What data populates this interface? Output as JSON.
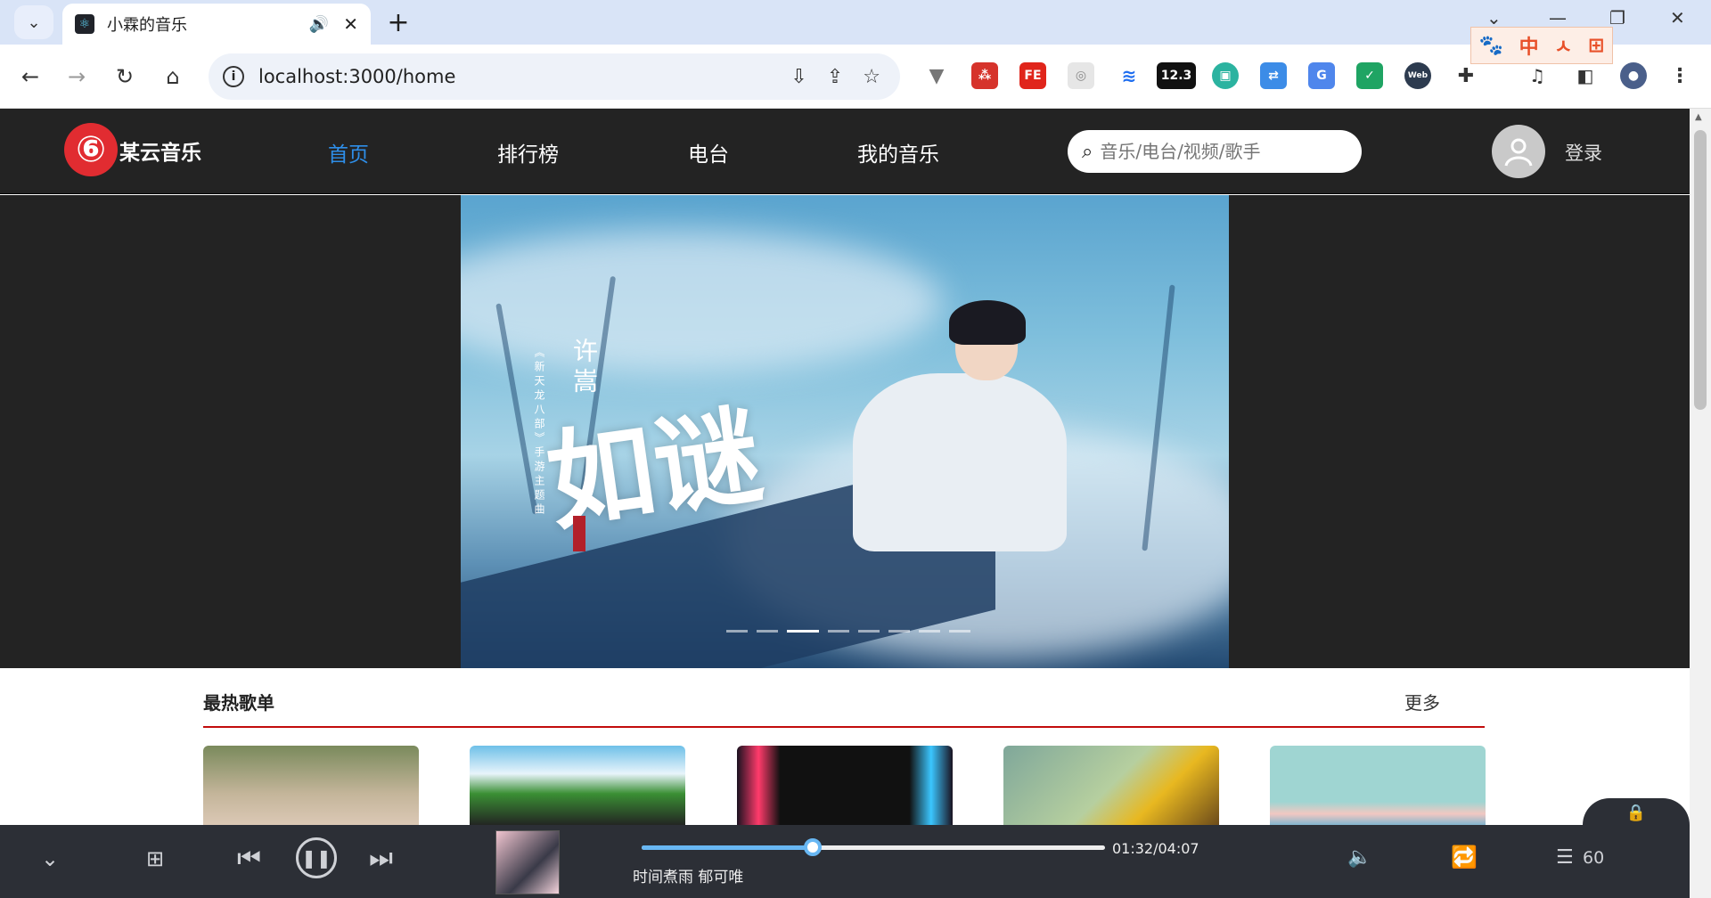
{
  "browser": {
    "tab_title": "小霖的音乐",
    "url": "localhost:3000/home",
    "ext_badge": "12.3"
  },
  "ime": {
    "items": [
      "中",
      "ㅅ",
      "⊞"
    ]
  },
  "header": {
    "logo_text": "某云音乐",
    "nav": [
      {
        "label": "首页",
        "active": true
      },
      {
        "label": "排行榜",
        "active": false
      },
      {
        "label": "电台",
        "active": false
      },
      {
        "label": "我的音乐",
        "active": false
      }
    ],
    "search_placeholder": "音乐/电台/视频/歌手",
    "login_label": "登录"
  },
  "banner": {
    "artist": "许嵩",
    "title": "如谜",
    "subtitle": "《新天龙八部》手游主题曲",
    "dot_count": 8,
    "active_dot": 2
  },
  "section": {
    "title": "最热歌单",
    "more": "更多"
  },
  "player": {
    "time": "01:32/04:07",
    "song": "时间煮雨  郁可唯",
    "progress": 0.37,
    "queue_count": "60"
  }
}
